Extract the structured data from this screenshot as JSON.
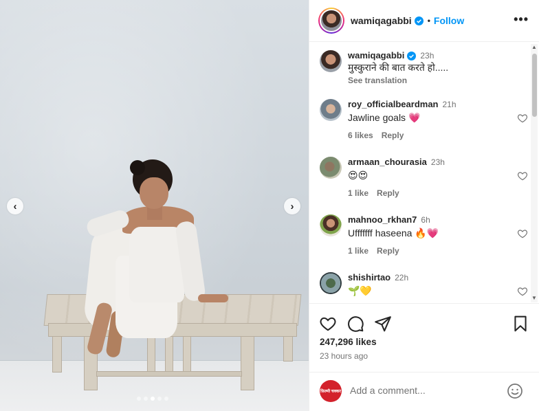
{
  "post": {
    "username": "wamiqagabbi",
    "follow_label": "Follow",
    "more_label": "•••",
    "separator": "•"
  },
  "media": {
    "prev_icon": "chevron-left-icon",
    "next_icon": "chevron-right-icon",
    "prev_glyph": "‹",
    "next_glyph": "›",
    "carousel_total": 5,
    "carousel_active_index": 3
  },
  "caption": {
    "username": "wamiqagabbi",
    "time": "23h",
    "text": "मुस्कुराने की बात करते हो.....",
    "see_translation": "See translation"
  },
  "comments": [
    {
      "username": "roy_officialbeardman",
      "time": "21h",
      "text": "Jawline goals 💗",
      "likes": "6 likes",
      "reply": "Reply"
    },
    {
      "username": "armaan_chourasia",
      "time": "23h",
      "text": "😍😍",
      "likes": "1 like",
      "reply": "Reply"
    },
    {
      "username": "mahnoo_rkhan7",
      "time": "6h",
      "text": "Ufffffff haseena 🔥💗",
      "likes": "1 like",
      "reply": "Reply"
    },
    {
      "username": "shishirtao",
      "time": "22h",
      "text": "🌱💛",
      "likes": "",
      "reply": ""
    }
  ],
  "actions": {
    "likes": "247,296 likes",
    "time_ago": "23 hours ago"
  },
  "add_comment": {
    "placeholder": "Add a comment...",
    "avatar_text": "फ़िल्मी चक्कर"
  },
  "colors": {
    "accent": "#0095f6",
    "verified": "#0095f6",
    "text_primary": "#262626",
    "text_secondary": "#737373"
  }
}
